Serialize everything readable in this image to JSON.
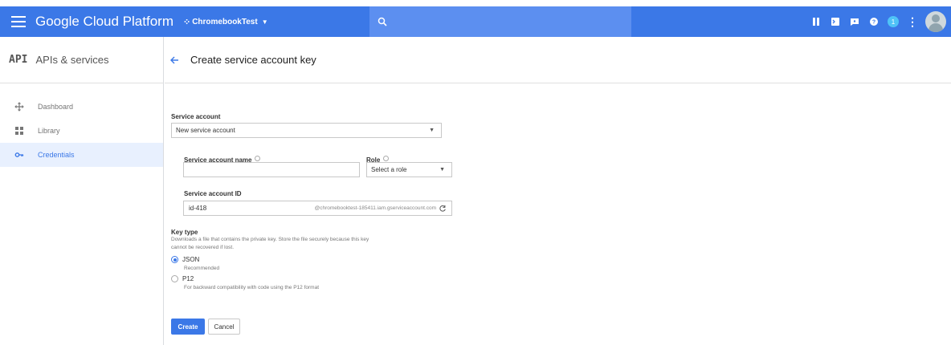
{
  "app": {
    "brand": "Google Cloud Platform",
    "project": "ChromebookTest",
    "accent_color": "#3b78e7",
    "topbar_icons": [
      "gift-icon",
      "cloud-shell-icon",
      "notifications-icon",
      "help-icon",
      "notifications-badge",
      "more-vert-icon",
      "account-avatar"
    ],
    "badge_count": "1"
  },
  "sidebar": {
    "logo": "API",
    "title": "APIs & services",
    "items": [
      {
        "label": "Dashboard",
        "icon": "dashboard-icon"
      },
      {
        "label": "Library",
        "icon": "library-icon"
      },
      {
        "label": "Credentials",
        "icon": "key-icon"
      }
    ]
  },
  "page": {
    "title": "Create service account key"
  },
  "form": {
    "service_account_label": "Service account",
    "service_account_value": "New service account",
    "name_label": "Service account name",
    "name_value": "",
    "role_label": "Role",
    "role_value": "Select a role",
    "id_label": "Service account ID",
    "id_value": "id-418",
    "id_suffix": "@chromebooktest-185411.iam.gserviceaccount.com",
    "key_type_label": "Key type",
    "key_type_desc_1": "Downloads a file that contains the private key. Store the file securely because this key",
    "key_type_desc_2": "cannot be recovered if lost.",
    "json_label": "JSON",
    "json_sub": "Recommended",
    "p12_label": "P12",
    "p12_sub": "For backward compatibility with code using the P12 format",
    "selected_key_type": "JSON"
  },
  "actions": {
    "create_label": "Create",
    "cancel_label": "Cancel"
  }
}
